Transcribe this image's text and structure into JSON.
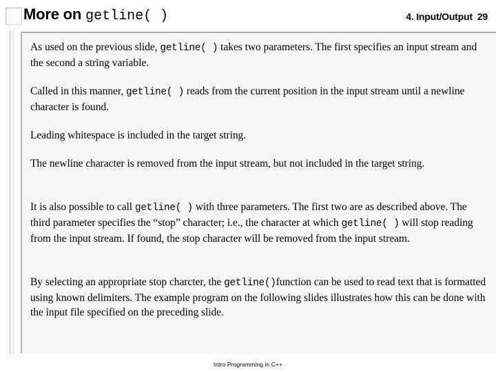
{
  "slide": {
    "title_prefix": "More on",
    "title_code": "getline( )",
    "section_label": "4. Input/Output",
    "page_number": "29",
    "footer": "Intro Programming in C++",
    "colors": {
      "background": "#ffffff",
      "content_background": "#f7f7f7",
      "border": "#a9a9a9",
      "text": "#000000"
    }
  },
  "body": {
    "paragraphs": [
      {
        "id": "p1",
        "runs": [
          {
            "type": "text",
            "value": "As used on the previous slide, "
          },
          {
            "type": "code",
            "value": "getline( )"
          },
          {
            "type": "text",
            "value": " takes two parameters.  The first specifies an input stream and the second a string variable."
          }
        ]
      },
      {
        "id": "p2",
        "runs": [
          {
            "type": "text",
            "value": "Called in this manner, "
          },
          {
            "type": "code",
            "value": "getline( )"
          },
          {
            "type": "text",
            "value": " reads from the current position in the input stream until a newline character is found."
          }
        ]
      },
      {
        "id": "p3",
        "runs": [
          {
            "type": "text",
            "value": "Leading whitespace is included in the target string."
          }
        ]
      },
      {
        "id": "p4",
        "runs": [
          {
            "type": "text",
            "value": "The newline character is removed from the input stream, but not included in the target string."
          }
        ]
      },
      {
        "id": "p5",
        "runs": [
          {
            "type": "text",
            "value": "It is also possible to call "
          },
          {
            "type": "code",
            "value": "getline( )"
          },
          {
            "type": "text",
            "value": " with three parameters.  The first two are as described above.  The third parameter specifies the “stop” character; i.e., the character at which "
          },
          {
            "type": "code",
            "value": "getline( )"
          },
          {
            "type": "text",
            "value": " will stop reading from the input stream.  If found, the stop character will be removed from the input stream."
          }
        ]
      },
      {
        "id": "p6",
        "runs": [
          {
            "type": "text",
            "value": "By selecting an appropriate stop charcter, the "
          },
          {
            "type": "code",
            "value": "getline()"
          },
          {
            "type": "text",
            "value": "function can be used to read text that is formatted using known delimiters.  The example program on the following slides illustrates how this can be done with the input file specified on the preceding slide."
          }
        ]
      }
    ]
  }
}
